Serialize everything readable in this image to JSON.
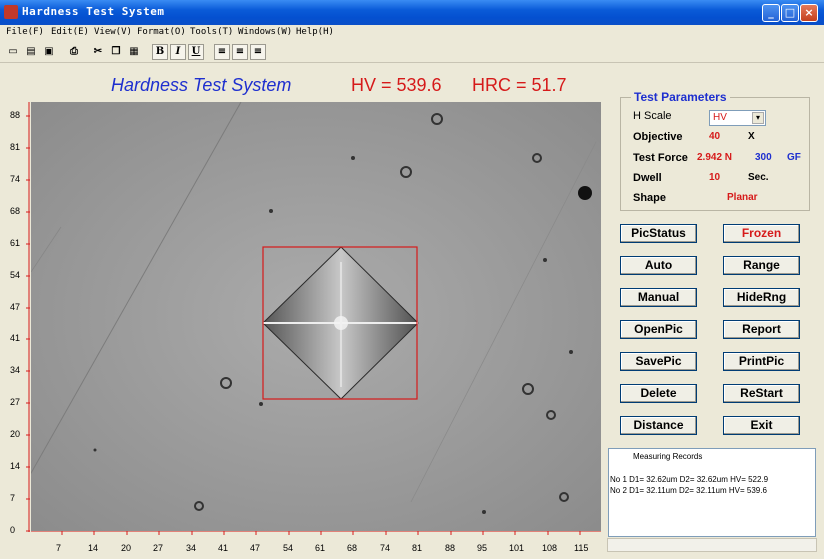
{
  "window": {
    "title": "Hardness Test System"
  },
  "menu": [
    "File(F)",
    "Edit(E)",
    "View(V)",
    "Format(O)",
    "Tools(T)",
    "Windows(W)",
    "Help(H)"
  ],
  "toolbar": {
    "bold": "B",
    "italic": "I",
    "underline": "U"
  },
  "header": {
    "app_title": "Hardness Test System",
    "hv": "HV = 539.6",
    "hrc": "HRC = 51.7"
  },
  "axes": {
    "y_labels": [
      "88",
      "81",
      "74",
      "68",
      "61",
      "54",
      "47",
      "41",
      "34",
      "27",
      "20",
      "14",
      "7",
      "0"
    ],
    "x_labels": [
      "7",
      "14",
      "20",
      "27",
      "34",
      "41",
      "47",
      "54",
      "61",
      "68",
      "74",
      "81",
      "88",
      "95",
      "101",
      "108",
      "115"
    ]
  },
  "params": {
    "legend": "Test Parameters",
    "h_scale_label": "H Scale",
    "h_scale_value": "HV",
    "objective_label": "Objective",
    "objective_value": "40",
    "objective_unit": "X",
    "force_label": "Test Force",
    "force_value": "2.942 N",
    "force_gf": "300",
    "force_gf_unit": "GF",
    "dwell_label": "Dwell",
    "dwell_value": "10",
    "dwell_unit": "Sec.",
    "shape_label": "Shape",
    "shape_value": "Planar"
  },
  "buttons": {
    "picstatus": "PicStatus",
    "frozen": "Frozen",
    "auto": "Auto",
    "range": "Range",
    "manual": "Manual",
    "hiderng": "HideRng",
    "openpic": "OpenPic",
    "report": "Report",
    "savepic": "SavePic",
    "printpic": "PrintPic",
    "delete": "Delete",
    "restart": "ReStart",
    "distance": "Distance",
    "exit": "Exit"
  },
  "records": {
    "title": "Measuring Records",
    "rows": [
      "No 1  D1= 32.62um  D2= 32.62um  HV= 522.9",
      "No 2  D1= 32.11um  D2= 32.11um  HV= 539.6"
    ]
  }
}
